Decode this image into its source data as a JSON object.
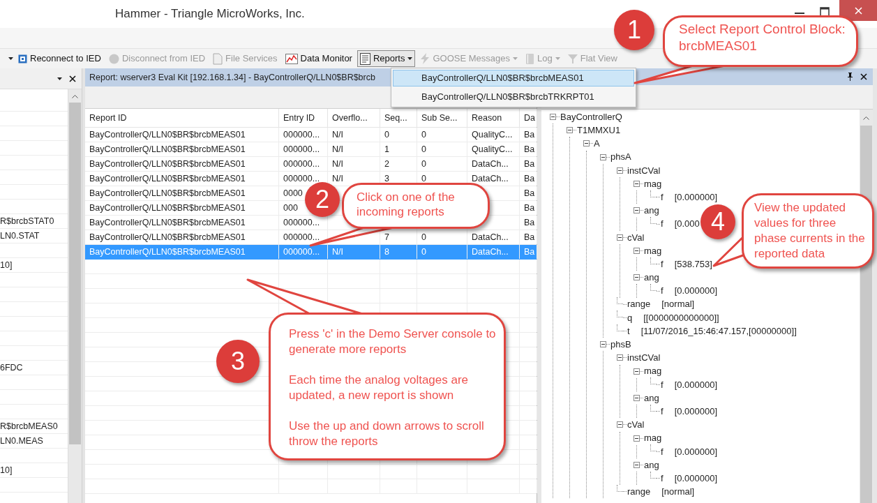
{
  "window": {
    "title": "Hammer - Triangle MicroWorks, Inc."
  },
  "toolbar": [
    {
      "label": "Reconnect to IED",
      "disabled": false,
      "dropdown": false,
      "open": false
    },
    {
      "label": "Disconnect from IED",
      "disabled": true,
      "dropdown": false,
      "open": false
    },
    {
      "label": "File Services",
      "disabled": true,
      "dropdown": false,
      "open": false
    },
    {
      "label": "Data Monitor",
      "disabled": false,
      "dropdown": false,
      "open": false
    },
    {
      "label": "Reports",
      "disabled": false,
      "dropdown": true,
      "open": true
    },
    {
      "label": "GOOSE Messages",
      "disabled": true,
      "dropdown": true,
      "open": false
    },
    {
      "label": "Log",
      "disabled": true,
      "dropdown": true,
      "open": false
    },
    {
      "label": "Flat View",
      "disabled": true,
      "dropdown": false,
      "open": false
    }
  ],
  "reports_menu": [
    {
      "label": "BayControllerQ/LLN0$BR$brcbMEAS01",
      "selected": true
    },
    {
      "label": "BayControllerQ/LLN0$BR$brcbTRKRPT01",
      "selected": false
    }
  ],
  "left_panel": {
    "rows": [
      {},
      {},
      {},
      {},
      {},
      {},
      {},
      {},
      {
        "text": "R$brcbSTAT0"
      },
      {
        "text": "LN0.STAT"
      },
      {},
      {
        "text": "10]"
      },
      {},
      {},
      {},
      {},
      {},
      {},
      {
        "text": "6FDC"
      },
      {},
      {},
      {},
      {
        "text": "R$brcbMEAS0"
      },
      {
        "text": "LN0.MEAS"
      },
      {},
      {
        "text": "10]"
      },
      {},
      {}
    ]
  },
  "report_panel": {
    "title": "Report: wserver3 Eval Kit [192.168.1.34] - BayControllerQ/LLN0$BR$brcb",
    "columns": [
      "Report ID",
      "Entry ID",
      "Overflo...",
      "Seq...",
      "Sub Se...",
      "Reason",
      "Da"
    ],
    "rows": [
      {
        "selected": false,
        "cells": [
          "BayControllerQ/LLN0$BR$brcbMEAS01",
          "000000...",
          "N/I",
          "0",
          "0",
          "QualityC...",
          "Ba"
        ]
      },
      {
        "selected": false,
        "cells": [
          "BayControllerQ/LLN0$BR$brcbMEAS01",
          "000000...",
          "N/I",
          "1",
          "0",
          "QualityC...",
          "Ba"
        ]
      },
      {
        "selected": false,
        "cells": [
          "BayControllerQ/LLN0$BR$brcbMEAS01",
          "000000...",
          "N/I",
          "2",
          "0",
          "DataCh...",
          "Ba"
        ]
      },
      {
        "selected": false,
        "cells": [
          "BayControllerQ/LLN0$BR$brcbMEAS01",
          "000000...",
          "N/I",
          "3",
          "0",
          "DataCh...",
          "Ba"
        ]
      },
      {
        "selected": false,
        "cells": [
          "BayControllerQ/LLN0$BR$brcbMEAS01",
          "0000",
          null,
          null,
          null,
          null,
          "Ba"
        ]
      },
      {
        "selected": false,
        "cells": [
          "BayControllerQ/LLN0$BR$brcbMEAS01",
          "000",
          null,
          null,
          null,
          null,
          "Ba"
        ]
      },
      {
        "selected": false,
        "cells": [
          "BayControllerQ/LLN0$BR$brcbMEAS01",
          "000000...",
          null,
          null,
          null,
          null,
          "Ba"
        ]
      },
      {
        "selected": false,
        "cells": [
          "BayControllerQ/LLN0$BR$brcbMEAS01",
          "000000...",
          null,
          "7",
          "0",
          "DataCh...",
          "Ba"
        ]
      },
      {
        "selected": true,
        "cells": [
          "BayControllerQ/LLN0$BR$brcbMEAS01",
          "000000...",
          "N/I",
          "8",
          "0",
          "DataCh...",
          "Ba"
        ]
      }
    ]
  },
  "tree": [
    {
      "label": "BayControllerQ",
      "expanded": true,
      "children": [
        {
          "label": "T1MMXU1",
          "expanded": true,
          "children": [
            {
              "label": "A",
              "expanded": true,
              "children": [
                {
                  "label": "phsA",
                  "expanded": true,
                  "children": [
                    {
                      "label": "instCVal",
                      "expanded": true,
                      "children": [
                        {
                          "label": "mag",
                          "expanded": true,
                          "children": [
                            {
                              "label": "f",
                              "value": "[0.000000]"
                            }
                          ]
                        },
                        {
                          "label": "ang",
                          "expanded": true,
                          "children": [
                            {
                              "label": "f",
                              "value": "[0.000"
                            }
                          ]
                        }
                      ]
                    },
                    {
                      "label": "cVal",
                      "expanded": true,
                      "children": [
                        {
                          "label": "mag",
                          "expanded": true,
                          "children": [
                            {
                              "label": "f",
                              "value": "[538.753]"
                            }
                          ]
                        },
                        {
                          "label": "ang",
                          "expanded": true,
                          "children": [
                            {
                              "label": "f",
                              "value": "[0.000000]"
                            }
                          ]
                        }
                      ]
                    },
                    {
                      "label": "range",
                      "value": "[normal]"
                    },
                    {
                      "label": "q",
                      "value": "[[0000000000000]]"
                    },
                    {
                      "label": "t",
                      "value": "[11/07/2016_15:46:47.157,[00000000]]"
                    }
                  ]
                },
                {
                  "label": "phsB",
                  "expanded": true,
                  "children": [
                    {
                      "label": "instCVal",
                      "expanded": true,
                      "children": [
                        {
                          "label": "mag",
                          "expanded": true,
                          "children": [
                            {
                              "label": "f",
                              "value": "[0.000000]"
                            }
                          ]
                        },
                        {
                          "label": "ang",
                          "expanded": true,
                          "children": [
                            {
                              "label": "f",
                              "value": "[0.000000]"
                            }
                          ]
                        }
                      ]
                    },
                    {
                      "label": "cVal",
                      "expanded": true,
                      "children": [
                        {
                          "label": "mag",
                          "expanded": true,
                          "children": [
                            {
                              "label": "f",
                              "value": "[0.000000]"
                            }
                          ]
                        },
                        {
                          "label": "ang",
                          "expanded": true,
                          "children": [
                            {
                              "label": "f",
                              "value": "[0.000000]"
                            }
                          ]
                        }
                      ]
                    },
                    {
                      "label": "range",
                      "value": "[normal]"
                    }
                  ]
                }
              ]
            }
          ]
        }
      ]
    }
  ],
  "callouts": [
    {
      "number": "1",
      "paragraphs": [
        "Select Report Control Block: brcbMEAS01"
      ]
    },
    {
      "number": "2",
      "paragraphs": [
        "Click on one of the incoming reports"
      ]
    },
    {
      "number": "3",
      "paragraphs": [
        "Press 'c' in the Demo Server console to generate more reports",
        "Each time the analog voltages are updated, a new report is shown",
        "Use the up and down arrows to scroll throw the reports"
      ]
    },
    {
      "number": "4",
      "paragraphs": [
        "View the updated values for three phase currents in the reported data"
      ]
    }
  ]
}
